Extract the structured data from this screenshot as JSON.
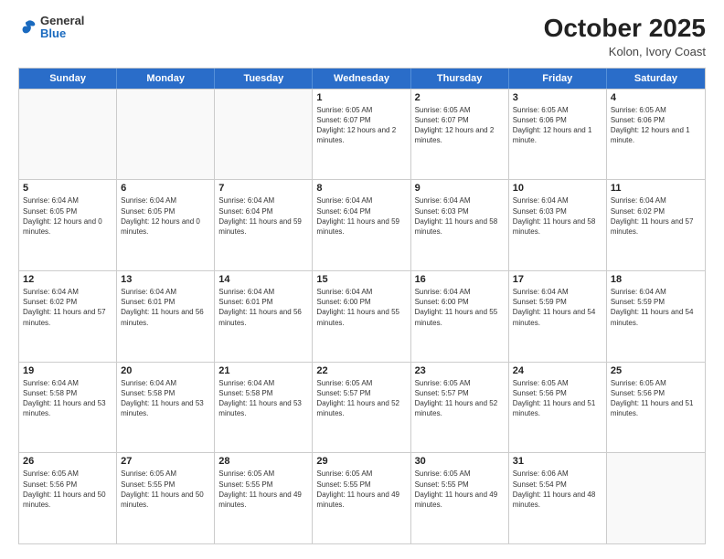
{
  "header": {
    "logo": {
      "general": "General",
      "blue": "Blue"
    },
    "month": "October 2025",
    "location": "Kolon, Ivory Coast"
  },
  "days_of_week": [
    "Sunday",
    "Monday",
    "Tuesday",
    "Wednesday",
    "Thursday",
    "Friday",
    "Saturday"
  ],
  "weeks": [
    [
      {
        "day": "",
        "info": ""
      },
      {
        "day": "",
        "info": ""
      },
      {
        "day": "",
        "info": ""
      },
      {
        "day": "1",
        "info": "Sunrise: 6:05 AM\nSunset: 6:07 PM\nDaylight: 12 hours and 2 minutes."
      },
      {
        "day": "2",
        "info": "Sunrise: 6:05 AM\nSunset: 6:07 PM\nDaylight: 12 hours and 2 minutes."
      },
      {
        "day": "3",
        "info": "Sunrise: 6:05 AM\nSunset: 6:06 PM\nDaylight: 12 hours and 1 minute."
      },
      {
        "day": "4",
        "info": "Sunrise: 6:05 AM\nSunset: 6:06 PM\nDaylight: 12 hours and 1 minute."
      }
    ],
    [
      {
        "day": "5",
        "info": "Sunrise: 6:04 AM\nSunset: 6:05 PM\nDaylight: 12 hours and 0 minutes."
      },
      {
        "day": "6",
        "info": "Sunrise: 6:04 AM\nSunset: 6:05 PM\nDaylight: 12 hours and 0 minutes."
      },
      {
        "day": "7",
        "info": "Sunrise: 6:04 AM\nSunset: 6:04 PM\nDaylight: 11 hours and 59 minutes."
      },
      {
        "day": "8",
        "info": "Sunrise: 6:04 AM\nSunset: 6:04 PM\nDaylight: 11 hours and 59 minutes."
      },
      {
        "day": "9",
        "info": "Sunrise: 6:04 AM\nSunset: 6:03 PM\nDaylight: 11 hours and 58 minutes."
      },
      {
        "day": "10",
        "info": "Sunrise: 6:04 AM\nSunset: 6:03 PM\nDaylight: 11 hours and 58 minutes."
      },
      {
        "day": "11",
        "info": "Sunrise: 6:04 AM\nSunset: 6:02 PM\nDaylight: 11 hours and 57 minutes."
      }
    ],
    [
      {
        "day": "12",
        "info": "Sunrise: 6:04 AM\nSunset: 6:02 PM\nDaylight: 11 hours and 57 minutes."
      },
      {
        "day": "13",
        "info": "Sunrise: 6:04 AM\nSunset: 6:01 PM\nDaylight: 11 hours and 56 minutes."
      },
      {
        "day": "14",
        "info": "Sunrise: 6:04 AM\nSunset: 6:01 PM\nDaylight: 11 hours and 56 minutes."
      },
      {
        "day": "15",
        "info": "Sunrise: 6:04 AM\nSunset: 6:00 PM\nDaylight: 11 hours and 55 minutes."
      },
      {
        "day": "16",
        "info": "Sunrise: 6:04 AM\nSunset: 6:00 PM\nDaylight: 11 hours and 55 minutes."
      },
      {
        "day": "17",
        "info": "Sunrise: 6:04 AM\nSunset: 5:59 PM\nDaylight: 11 hours and 54 minutes."
      },
      {
        "day": "18",
        "info": "Sunrise: 6:04 AM\nSunset: 5:59 PM\nDaylight: 11 hours and 54 minutes."
      }
    ],
    [
      {
        "day": "19",
        "info": "Sunrise: 6:04 AM\nSunset: 5:58 PM\nDaylight: 11 hours and 53 minutes."
      },
      {
        "day": "20",
        "info": "Sunrise: 6:04 AM\nSunset: 5:58 PM\nDaylight: 11 hours and 53 minutes."
      },
      {
        "day": "21",
        "info": "Sunrise: 6:04 AM\nSunset: 5:58 PM\nDaylight: 11 hours and 53 minutes."
      },
      {
        "day": "22",
        "info": "Sunrise: 6:05 AM\nSunset: 5:57 PM\nDaylight: 11 hours and 52 minutes."
      },
      {
        "day": "23",
        "info": "Sunrise: 6:05 AM\nSunset: 5:57 PM\nDaylight: 11 hours and 52 minutes."
      },
      {
        "day": "24",
        "info": "Sunrise: 6:05 AM\nSunset: 5:56 PM\nDaylight: 11 hours and 51 minutes."
      },
      {
        "day": "25",
        "info": "Sunrise: 6:05 AM\nSunset: 5:56 PM\nDaylight: 11 hours and 51 minutes."
      }
    ],
    [
      {
        "day": "26",
        "info": "Sunrise: 6:05 AM\nSunset: 5:56 PM\nDaylight: 11 hours and 50 minutes."
      },
      {
        "day": "27",
        "info": "Sunrise: 6:05 AM\nSunset: 5:55 PM\nDaylight: 11 hours and 50 minutes."
      },
      {
        "day": "28",
        "info": "Sunrise: 6:05 AM\nSunset: 5:55 PM\nDaylight: 11 hours and 49 minutes."
      },
      {
        "day": "29",
        "info": "Sunrise: 6:05 AM\nSunset: 5:55 PM\nDaylight: 11 hours and 49 minutes."
      },
      {
        "day": "30",
        "info": "Sunrise: 6:05 AM\nSunset: 5:55 PM\nDaylight: 11 hours and 49 minutes."
      },
      {
        "day": "31",
        "info": "Sunrise: 6:06 AM\nSunset: 5:54 PM\nDaylight: 11 hours and 48 minutes."
      },
      {
        "day": "",
        "info": ""
      }
    ]
  ]
}
